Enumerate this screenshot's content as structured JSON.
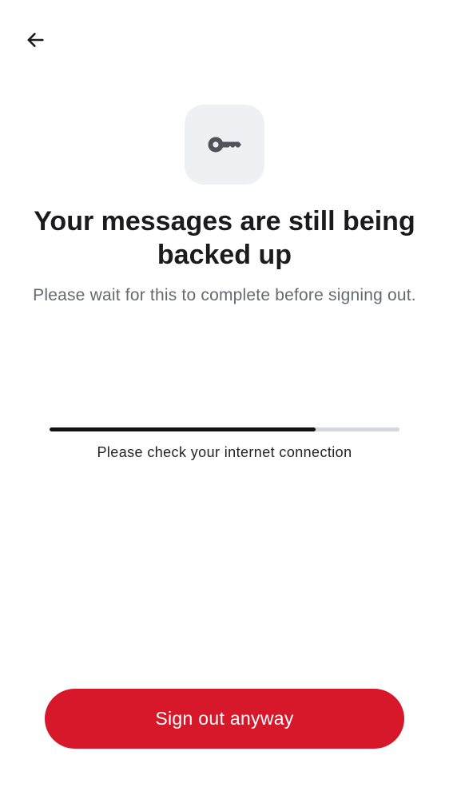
{
  "header": {
    "back_icon": "arrow-left-icon"
  },
  "hero": {
    "icon": "key-icon",
    "title": "Your messages are still being backed up",
    "subtitle": "Please wait for this to complete before signing out."
  },
  "backup": {
    "progress": 0.76,
    "status": "Please check your internet connection"
  },
  "actions": {
    "sign_out_label": "Sign out anyway"
  },
  "colors": {
    "accent": "#d7182a",
    "progress_fill": "#111111",
    "progress_track": "#d3d8e0",
    "icon_tile": "#eff0f3"
  }
}
